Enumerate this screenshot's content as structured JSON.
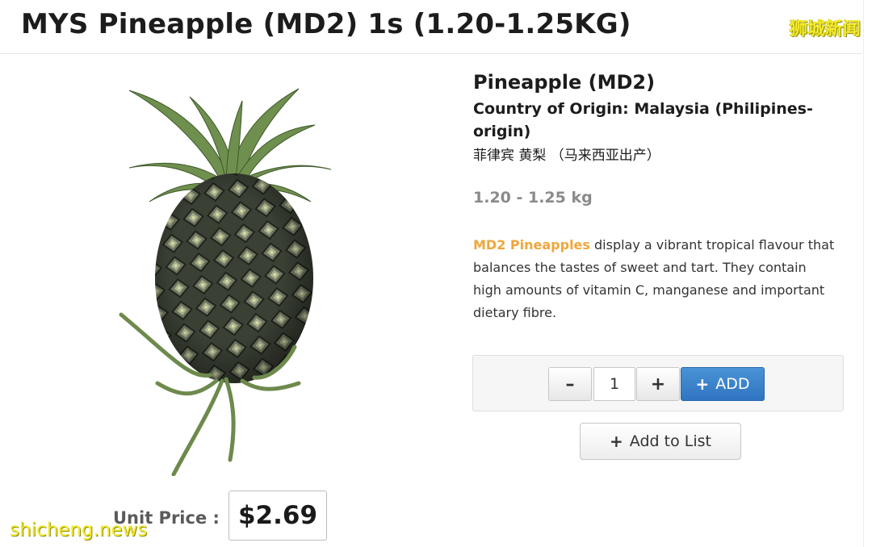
{
  "header": {
    "title": "MYS Pineapple (MD2) 1s (1.20-1.25KG)"
  },
  "watermarks": {
    "top_right": "狮城新闻",
    "bottom_left": "shicheng.news"
  },
  "product": {
    "image_icon": "pineapple-image",
    "name": "Pineapple (MD2)",
    "origin": "Country of Origin: Malaysia (Philipines-origin)",
    "chinese_name": "菲律宾 黄梨 （马来西亚出产）",
    "weight": "1.20 - 1.25 kg",
    "description_highlight": "MD2 Pineapples",
    "description_rest": " display a vibrant tropical flavour that balances the tastes of sweet and tart. They contain high amounts of vitamin C, manganese and important dietary fibre."
  },
  "pricing": {
    "unit_price_label": "Unit Price :",
    "price": "$2.69"
  },
  "cart": {
    "minus_label": "–",
    "quantity": "1",
    "plus_label": "+",
    "add_icon": "plus-icon",
    "add_label": "ADD",
    "add_to_list_icon": "plus-icon",
    "add_to_list_label": "Add to List"
  },
  "colors": {
    "accent_blue": "#3a82cc",
    "highlight_orange": "#f0a63a",
    "watermark_yellow": "#f3ea2a"
  }
}
